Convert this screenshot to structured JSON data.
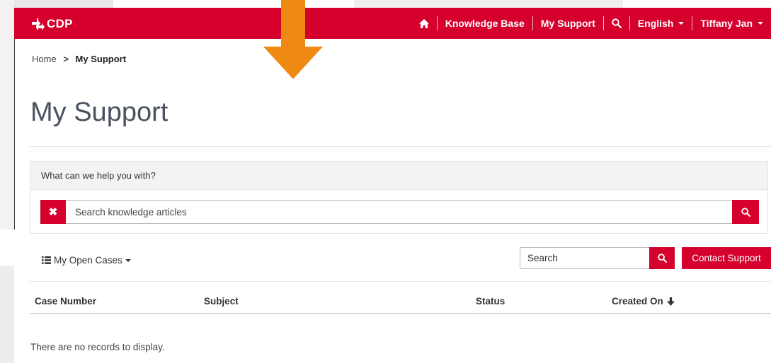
{
  "brand": {
    "logo_text": "CDP",
    "accent_color": "#d5002b",
    "arrow_color": "#ee8a12"
  },
  "nav": {
    "home_icon": "home-icon",
    "knowledge_base": "Knowledge Base",
    "my_support": "My Support",
    "search_icon": "search-icon",
    "language": "English",
    "user": "Tiffany Jan"
  },
  "breadcrumb": {
    "home": "Home",
    "separator": ">",
    "current": "My Support"
  },
  "page": {
    "title": "My Support"
  },
  "kb_search": {
    "heading": "What can we help you with?",
    "placeholder": "Search knowledge articles",
    "value": "",
    "clear_icon": "close-icon",
    "submit_icon": "search-icon"
  },
  "cases": {
    "view_label": "My Open Cases",
    "search_placeholder": "Search",
    "contact_label": "Contact Support",
    "columns": [
      "Case Number",
      "Subject",
      "Status",
      "Created On"
    ],
    "sort_column": "Created On",
    "sort_direction": "descending",
    "empty_message": "There are no records to display."
  }
}
